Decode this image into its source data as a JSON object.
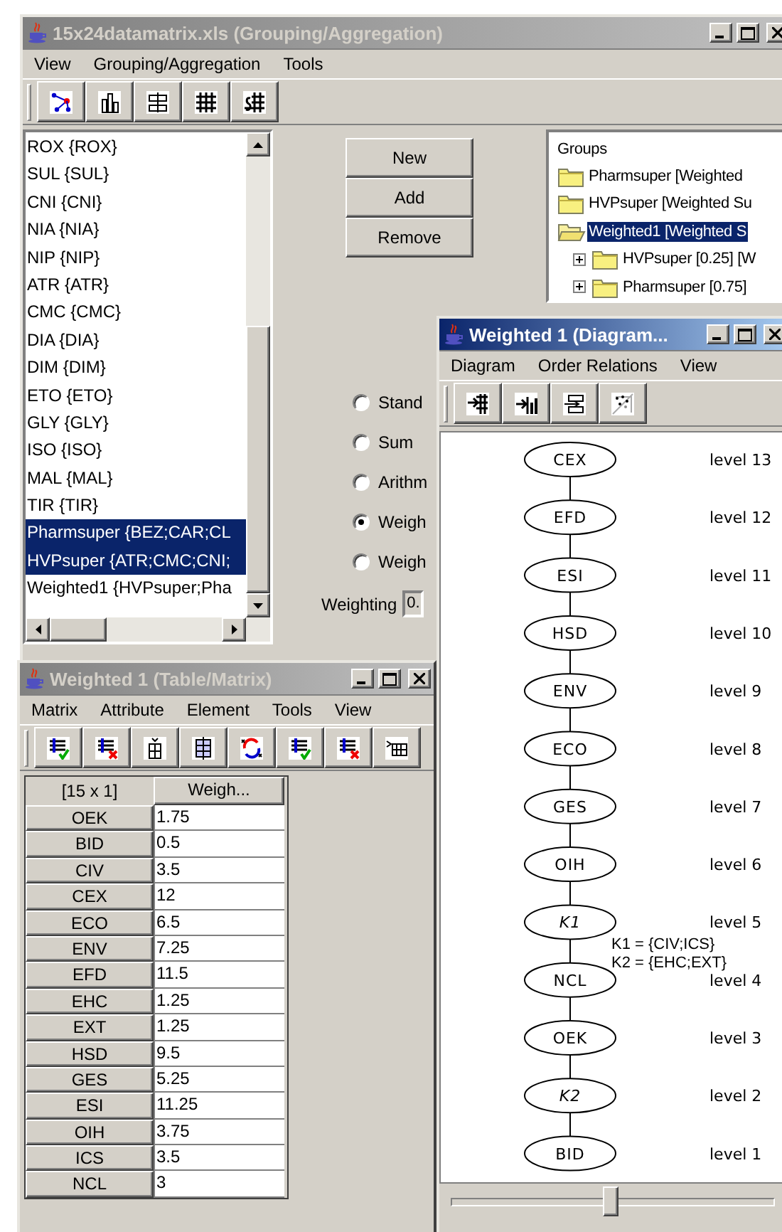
{
  "main_window": {
    "title": "15x24datamatrix.xls (Grouping/Aggregation)",
    "active": false,
    "menu": [
      "View",
      "Grouping/Aggregation",
      "Tools"
    ],
    "element_list": [
      {
        "label": "ROX {ROX}",
        "selected": false
      },
      {
        "label": "SUL {SUL}",
        "selected": false
      },
      {
        "label": "CNI {CNI}",
        "selected": false
      },
      {
        "label": "NIA {NIA}",
        "selected": false
      },
      {
        "label": "NIP {NIP}",
        "selected": false
      },
      {
        "label": "ATR {ATR}",
        "selected": false
      },
      {
        "label": "CMC {CMC}",
        "selected": false
      },
      {
        "label": "DIA {DIA}",
        "selected": false
      },
      {
        "label": "DIM {DIM}",
        "selected": false
      },
      {
        "label": "ETO {ETO}",
        "selected": false
      },
      {
        "label": "GLY {GLY}",
        "selected": false
      },
      {
        "label": "ISO {ISO}",
        "selected": false
      },
      {
        "label": "MAL {MAL}",
        "selected": false
      },
      {
        "label": "TIR {TIR}",
        "selected": false
      },
      {
        "label": "Pharmsuper {BEZ;CAR;CL",
        "selected": true
      },
      {
        "label": "HVPsuper {ATR;CMC;CNI;",
        "selected": true
      },
      {
        "label": "Weighted1 {HVPsuper;Pha",
        "selected": false
      }
    ],
    "buttons": [
      "New",
      "Add",
      "Remove"
    ],
    "aggregation_options": [
      {
        "label": "Stand",
        "selected": false
      },
      {
        "label": "Sum",
        "selected": false
      },
      {
        "label": "Arithm",
        "selected": false
      },
      {
        "label": "Weigh",
        "selected": true
      },
      {
        "label": "Weigh",
        "selected": false
      }
    ],
    "weighting": {
      "label": "Weighting",
      "value": "0."
    },
    "groups_tree": {
      "label": "Groups",
      "children": [
        {
          "label": "Pharmsuper [Weighted",
          "selected": false,
          "expanded": false
        },
        {
          "label": "HVPsuper [Weighted Su",
          "selected": false,
          "expanded": false
        },
        {
          "label": "Weighted1 [Weighted S",
          "selected": true,
          "expanded": true,
          "children": [
            {
              "label": "HVPsuper [0.25] [W",
              "selected": false,
              "expanded": false
            },
            {
              "label": "Pharmsuper [0.75]",
              "selected": false,
              "expanded": false
            }
          ]
        }
      ]
    }
  },
  "table_window": {
    "title": "Weighted 1 (Table/Matrix)",
    "active": false,
    "menu": [
      "Matrix",
      "Attribute",
      "Element",
      "Tools",
      "View"
    ],
    "corner": "[15 x 1]",
    "column": "Weigh...",
    "rows": [
      {
        "label": "OEK",
        "value": "1.75"
      },
      {
        "label": "BID",
        "value": "0.5"
      },
      {
        "label": "CIV",
        "value": "3.5"
      },
      {
        "label": "CEX",
        "value": "12"
      },
      {
        "label": "ECO",
        "value": "6.5"
      },
      {
        "label": "ENV",
        "value": "7.25"
      },
      {
        "label": "EFD",
        "value": "11.5"
      },
      {
        "label": "EHC",
        "value": "1.25"
      },
      {
        "label": "EXT",
        "value": "1.25"
      },
      {
        "label": "HSD",
        "value": "9.5"
      },
      {
        "label": "GES",
        "value": "5.25"
      },
      {
        "label": "ESI",
        "value": "11.25"
      },
      {
        "label": "OIH",
        "value": "3.75"
      },
      {
        "label": "ICS",
        "value": "3.5"
      },
      {
        "label": "NCL",
        "value": "3"
      }
    ]
  },
  "diagram_window": {
    "title": "Weighted 1 (Diagram...",
    "active": true,
    "menu": [
      "Diagram",
      "Order Relations",
      "View"
    ],
    "nodes": [
      {
        "label": "CEX",
        "kind": "element",
        "level_label": "level 13"
      },
      {
        "label": "EFD",
        "kind": "element",
        "level_label": "level 12"
      },
      {
        "label": "ESI",
        "kind": "element",
        "level_label": "level 11"
      },
      {
        "label": "HSD",
        "kind": "element",
        "level_label": "level 10"
      },
      {
        "label": "ENV",
        "kind": "element",
        "level_label": "level 9"
      },
      {
        "label": "ECO",
        "kind": "element",
        "level_label": "level 8"
      },
      {
        "label": "GES",
        "kind": "element",
        "level_label": "level 7"
      },
      {
        "label": "OIH",
        "kind": "element",
        "level_label": "level 6"
      },
      {
        "label": "K1",
        "kind": "class",
        "level_label": "level 5"
      },
      {
        "label": "NCL",
        "kind": "element",
        "level_label": "level 4"
      },
      {
        "label": "OEK",
        "kind": "element",
        "level_label": "level 3"
      },
      {
        "label": "K2",
        "kind": "class",
        "level_label": "level 2"
      },
      {
        "label": "BID",
        "kind": "element",
        "level_label": "level 1"
      }
    ],
    "legend": [
      "K1 = {CIV;ICS}",
      "K2 = {EHC;EXT}"
    ],
    "zoom_slider": {
      "level": 0.49
    }
  }
}
